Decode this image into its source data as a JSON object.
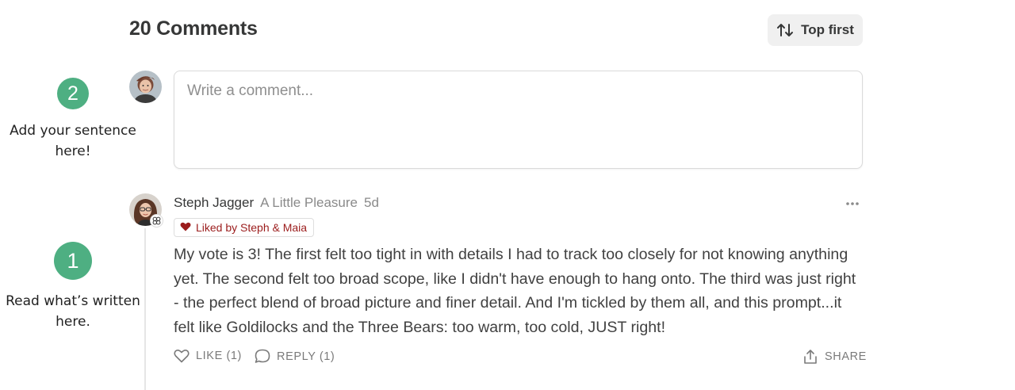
{
  "header": {
    "title": "20 Comments",
    "sort_label": "Top first",
    "sort_icon": "sort-arrows-icon"
  },
  "composer": {
    "placeholder": "Write a comment...",
    "avatar_icon": "user-avatar"
  },
  "annotations": {
    "step2": {
      "number": "2",
      "text": "Add your sentence here!"
    },
    "step1": {
      "number": "1",
      "text": "Read what’s written here."
    },
    "color": "#4eaf82"
  },
  "comment": {
    "author": "Steph Jagger",
    "publication": "A Little Pleasure",
    "age": "5d",
    "liked_by": "Liked by Steph & Maia",
    "body_lines": [
      "My vote is 3! The first felt too tight in with details I had to track too closely for not knowing anything",
      "yet. The second felt too broad scope, like I didn't have enough to hang onto. The third was just right",
      "- the perfect blend of broad picture and finer detail. And I'm tickled by them all, and this prompt...it",
      "felt like Goldilocks and the Three Bears: too warm, too cold, JUST right!"
    ],
    "actions": {
      "like": "LIKE (1)",
      "reply": "REPLY (1)",
      "share": "SHARE"
    }
  },
  "colors": {
    "liked_heart": "#9b1c1c",
    "accent_green": "#4eaf82"
  }
}
